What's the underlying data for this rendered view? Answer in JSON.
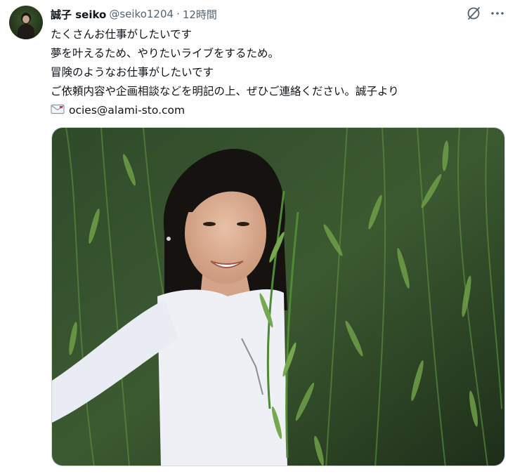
{
  "tweet": {
    "author_name": "誠子 seiko",
    "handle": "@seiko1204",
    "separator": "·",
    "time": "12時間",
    "lines": [
      "たくさんお仕事がしたいです",
      "夢を叶えるため、やりたいライブをするため。",
      "冒険のようなお仕事がしたいです",
      "ご依頼内容や企画相談などを明記の上、ぜひご連絡ください。誠子より"
    ],
    "email": "ocies@alami-sto.com",
    "email_icon": "envelope-icon"
  },
  "icons": {
    "grok": "grok-icon",
    "more": "more-icon",
    "avatar": "avatar"
  },
  "colors": {
    "text": "#0f1419",
    "secondary": "#536471",
    "border": "#cfd9de"
  }
}
